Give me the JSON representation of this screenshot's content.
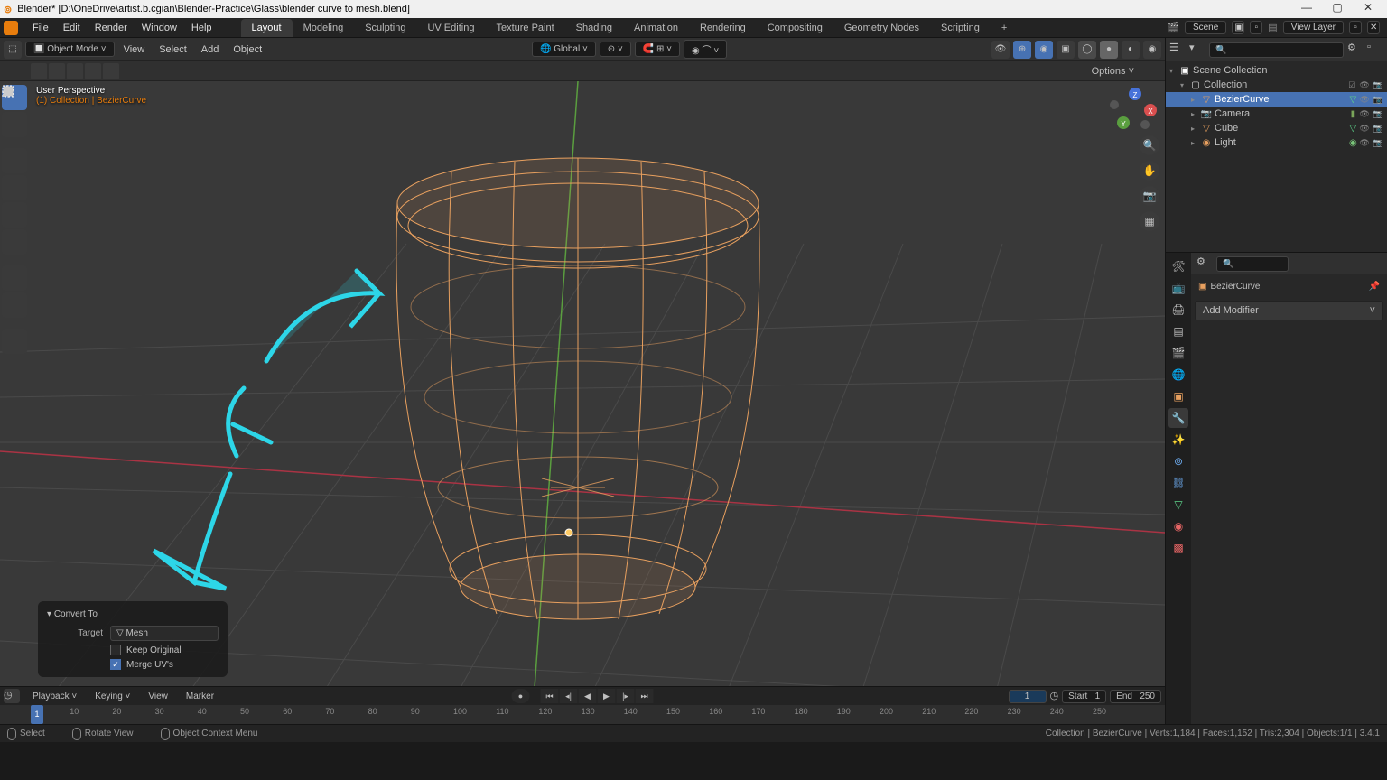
{
  "title": "Blender* [D:\\OneDrive\\artist.b.cgian\\Blender-Practice\\Glass\\blender curve to mesh.blend]",
  "menus": {
    "file": "File",
    "edit": "Edit",
    "render": "Render",
    "window": "Window",
    "help": "Help"
  },
  "workspaces": [
    "Layout",
    "Modeling",
    "Sculpting",
    "UV Editing",
    "Texture Paint",
    "Shading",
    "Animation",
    "Rendering",
    "Compositing",
    "Geometry Nodes",
    "Scripting"
  ],
  "active_workspace": "Layout",
  "scene_label": "Scene",
  "viewlayer_label": "View Layer",
  "header": {
    "mode": "Object Mode",
    "menus": [
      "View",
      "Select",
      "Add",
      "Object"
    ],
    "orient": "Global",
    "options": "Options"
  },
  "overlay": {
    "persp": "User Perspective",
    "coll": "(1) Collection | BezierCurve"
  },
  "op_panel": {
    "title": "Convert To",
    "target_label": "Target",
    "target_value": "Mesh",
    "keep_label": "Keep Original",
    "keep_checked": false,
    "merge_label": "Merge UV's",
    "merge_checked": true
  },
  "outliner": {
    "scene": "Scene Collection",
    "collection": "Collection",
    "items": [
      {
        "name": "BezierCurve",
        "icon": "▽",
        "sel": true,
        "color": "#5dd28a"
      },
      {
        "name": "Camera",
        "icon": "📷",
        "sel": false,
        "color": "#e8a05f"
      },
      {
        "name": "Cube",
        "icon": "▽",
        "sel": false,
        "color": "#e8a05f"
      },
      {
        "name": "Light",
        "icon": "◉",
        "sel": false,
        "color": "#e8a05f"
      }
    ]
  },
  "properties": {
    "crumb": "BezierCurve",
    "add_modifier": "Add Modifier"
  },
  "timeline": {
    "playback": "Playback",
    "keying": "Keying",
    "view": "View",
    "marker": "Marker",
    "current": 1,
    "start_label": "Start",
    "start": 1,
    "end_label": "End",
    "end": 250,
    "ticks": [
      10,
      20,
      30,
      40,
      50,
      60,
      70,
      80,
      90,
      100,
      110,
      120,
      130,
      140,
      150,
      160,
      170,
      180,
      190,
      200,
      210,
      220,
      230,
      240,
      250
    ]
  },
  "statusbar": {
    "select": "Select",
    "rotate": "Rotate View",
    "context": "Object Context Menu",
    "stats": "Collection | BezierCurve | Verts:1,184 | Faces:1,152 | Tris:2,304 | Objects:1/1 | 3.4.1"
  }
}
